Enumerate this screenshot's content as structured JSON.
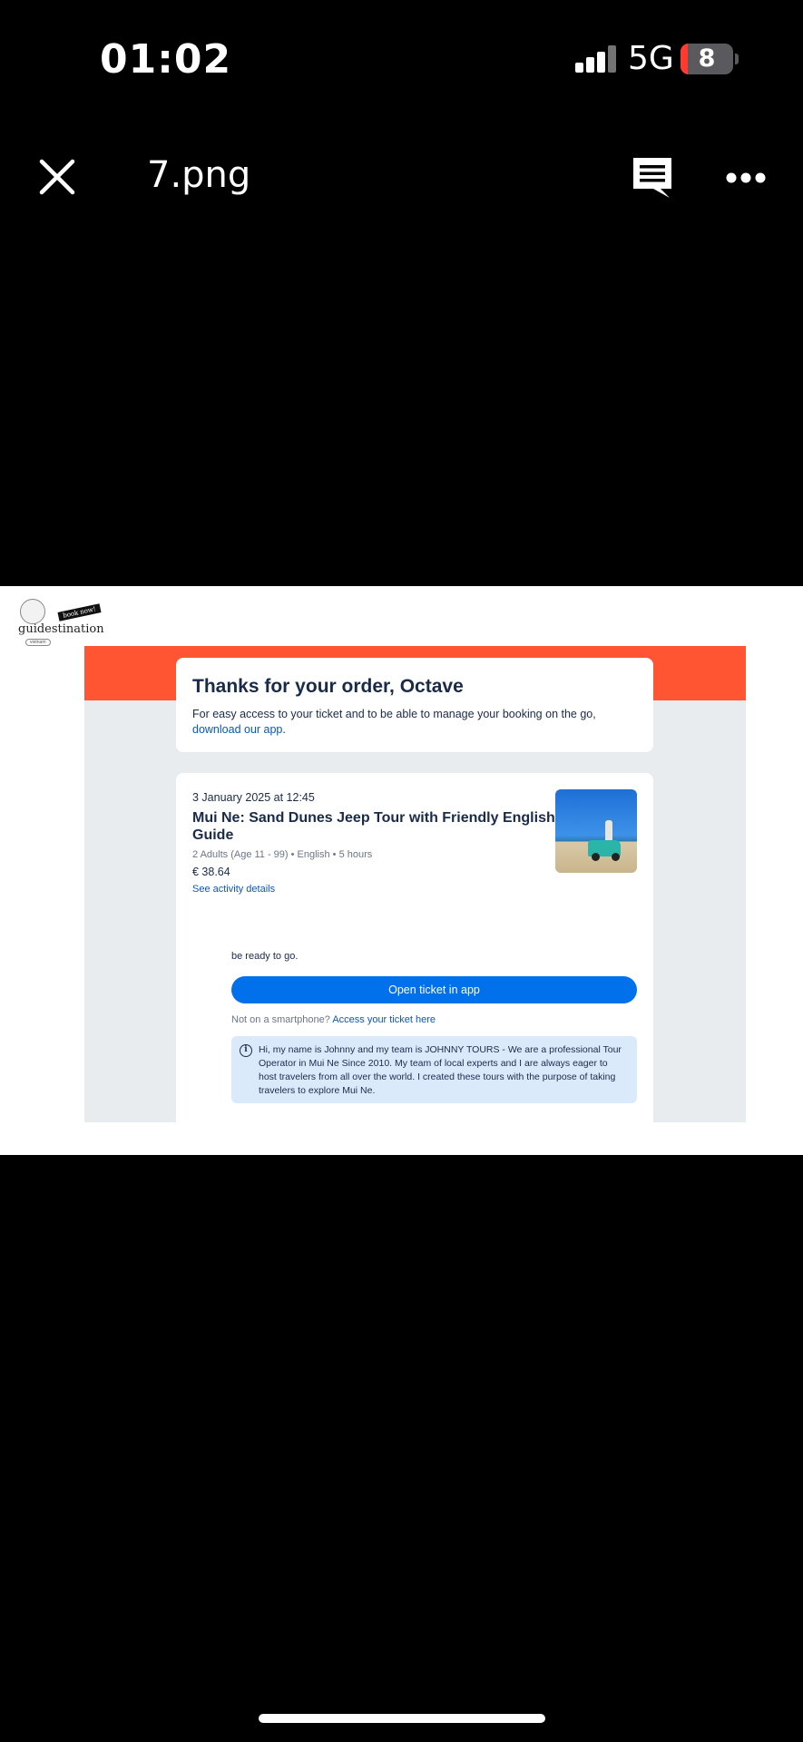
{
  "status_bar": {
    "time": "01:02",
    "network": "5G",
    "battery_level": "8",
    "battery_color": "#ff3b30"
  },
  "viewer": {
    "file_name": "7.png",
    "close_icon": "close-icon",
    "comment_icon": "comment-icon",
    "more_icon": "more-icon"
  },
  "brand": {
    "name": "guidestination",
    "tag": "book now!",
    "sub": "vietnam"
  },
  "email": {
    "banner_color": "#ff5533",
    "title": "Thanks for your order, Octave",
    "intro_text": "For easy access to your ticket and to be able to manage your booking on the go,",
    "intro_link": "download our app",
    "intro_end": ".",
    "activity": {
      "date": "3 January 2025 at 12:45",
      "title": "Mui Ne: Sand Dunes Jeep Tour with Friendly English Guide",
      "meta": "2 Adults (Age 11 - 99) • English • 5 hours",
      "price": "€ 38.64",
      "details_link": "See activity details"
    },
    "ready_text": "be ready to go.",
    "open_button": "Open ticket in app",
    "not_smartphone": "Not on a smartphone?",
    "access_link": "Access your ticket here",
    "info_text": "Hi, my name is Johnny and my team is JOHNNY TOURS - We are a professional Tour Operator in Mui Ne Since 2010. My team of local experts and I are always eager to host travelers from all over the world. I created these tours with the purpose of taking travelers to explore Mui Ne.",
    "button_color": "#0071eb"
  }
}
